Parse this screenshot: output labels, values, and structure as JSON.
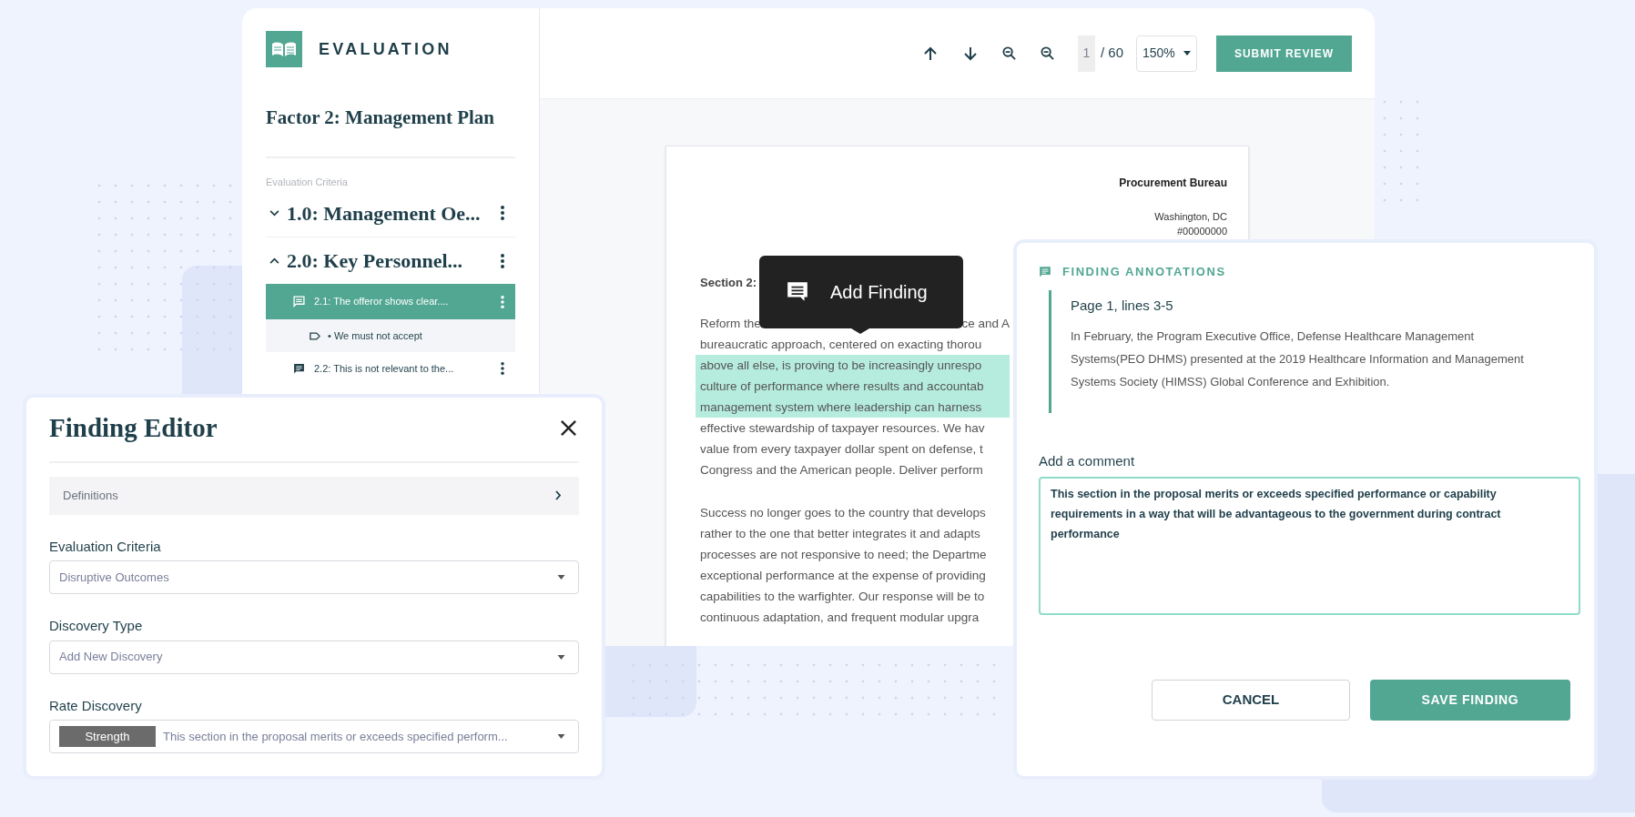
{
  "app": {
    "logo_text": "EVALUATION"
  },
  "sidebar": {
    "factor_title": "Factor 2: Management Plan",
    "section_label": "Evaluation Criteria",
    "criteria": [
      {
        "label": "1.0: Management Oe...",
        "expanded": false
      },
      {
        "label": "2.0: Key Personnel...",
        "expanded": true,
        "children": [
          {
            "label": "2.1: The offeror shows clear....",
            "selected": true,
            "children": [
              {
                "bullet": "•",
                "label": "We must not accept"
              }
            ]
          },
          {
            "label": "2.2: This is not relevant to the...",
            "selected": false
          }
        ]
      }
    ]
  },
  "toolbar": {
    "page": "1",
    "page_total": "/ 60",
    "zoom": "150%",
    "submit": "SUBMIT REVIEW"
  },
  "document": {
    "org": "Procurement Bureau",
    "address_lines": [
      "Washington, DC",
      "#00000000"
    ],
    "section_heading": "Section 2:",
    "paragraphs": [
      [
        {
          "segments": [
            "Reform the",
            "ce and A"
          ],
          "highlighted": false
        },
        {
          "segments": [
            "bureaucratic approach, centered on exacting thorou"
          ],
          "highlighted": false
        },
        {
          "segments": [
            "above all else, is proving to be increasingly unrespo"
          ],
          "highlighted": true
        },
        {
          "segments": [
            "culture of performance where results and accountab"
          ],
          "highlighted": true
        },
        {
          "segments": [
            "management system where leadership can harness"
          ],
          "highlighted": true
        },
        {
          "segments": [
            "effective stewardship of taxpayer resources. We hav"
          ],
          "highlighted": false
        },
        {
          "segments": [
            "value from every taxpayer dollar spent on defense, t"
          ],
          "highlighted": false
        },
        {
          "segments": [
            "Congress and the American people. Deliver perform"
          ],
          "highlighted": false
        }
      ],
      [
        {
          "segments": [
            "Success no longer goes to the country that develops"
          ],
          "highlighted": false
        },
        {
          "segments": [
            "rather to the one that better integrates it and adapts"
          ],
          "highlighted": false
        },
        {
          "segments": [
            "processes are not responsive to need; the Departme"
          ],
          "highlighted": false
        },
        {
          "segments": [
            "exceptional performance at the expense of providing"
          ],
          "highlighted": false
        },
        {
          "segments": [
            "capabilities to the warfighter. Our response will be to"
          ],
          "highlighted": false
        },
        {
          "segments": [
            "continuous adaptation, and frequent modular upgra"
          ],
          "highlighted": false
        }
      ]
    ]
  },
  "tooltip": {
    "label": "Add Finding"
  },
  "finding_editor": {
    "title": "Finding Editor",
    "definitions": "Definitions",
    "fields": [
      {
        "label": "Evaluation Criteria",
        "value": "Disruptive Outcomes"
      },
      {
        "label": "Discovery Type",
        "value": "Add New Discovery"
      },
      {
        "label": "Rate Discovery",
        "badge": "Strength",
        "value": "This section in the proposal merits or exceeds specified perform..."
      }
    ]
  },
  "annotations": {
    "heading": "FINDING ANNOTATIONS",
    "quote_title": "Page 1, lines 3-5",
    "quote_text": "In February, the Program Executive Office, Defense Healthcare Management Systems(PEO DHMS) presented at the 2019 Healthcare Information and Management Systems Society (HIMSS) Global Conference and Exhibition.",
    "comment_label": "Add a comment",
    "comment": "This section in the proposal merits or exceeds specified performance or capability requirements in a way that will be advantageous to the government during contract performance",
    "cancel": "CANCEL",
    "save": "SAVE FINDING"
  }
}
